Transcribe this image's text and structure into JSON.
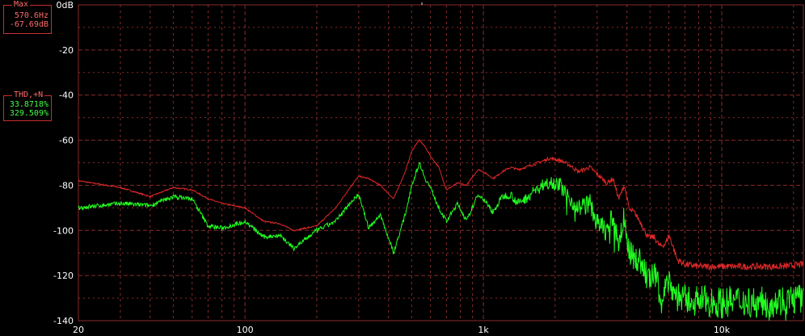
{
  "readouts": {
    "max": {
      "title": "Max",
      "frequency": "570.6Hz",
      "level": "-67.69dB"
    },
    "thd": {
      "title": "THD,+N",
      "value1": "33.8718%",
      "value2": "329.509%"
    }
  },
  "colors": {
    "background": "#000000",
    "grid": "#8a2a2a",
    "series_total": "#e02828",
    "series_residual": "#22ff22",
    "text": "#ffffff"
  },
  "chart_data": {
    "type": "line",
    "title": "",
    "xlabel": "",
    "ylabel": "",
    "x_scale": "log",
    "xlim": [
      20,
      22000
    ],
    "ylim": [
      -140,
      0
    ],
    "y_ticks": [
      0,
      -20,
      -40,
      -60,
      -80,
      -100,
      -120,
      -140
    ],
    "y_tick_labels": [
      "0dB",
      "-20",
      "-40",
      "-60",
      "-80",
      "-100",
      "-120",
      "-140"
    ],
    "x_ticks": [
      20,
      100,
      1000,
      10000
    ],
    "x_tick_labels": [
      "20",
      "100",
      "1k",
      "10k"
    ],
    "grid": true,
    "series": [
      {
        "color": "#e02828",
        "x": [
          20,
          30,
          40,
          50,
          60,
          70,
          80,
          100,
          120,
          140,
          160,
          200,
          240,
          280,
          300,
          330,
          370,
          420,
          470,
          500,
          520,
          540,
          570,
          600,
          650,
          700,
          780,
          850,
          950,
          1000,
          1100,
          1200,
          1300,
          1400,
          1500,
          1700,
          1900,
          2100,
          2300,
          2500,
          2800,
          3000,
          3300,
          3500,
          3700,
          3900,
          4100,
          4300,
          4600,
          4900,
          5200,
          5500,
          5800,
          6000,
          6200,
          6500,
          7000,
          8000,
          10000,
          12000,
          15000,
          18000,
          22000
        ],
        "y": [
          -78,
          -81,
          -85,
          -81,
          -82,
          -86,
          -88,
          -90,
          -96,
          -97,
          -100,
          -98,
          -90,
          -80,
          -76,
          -77,
          -80,
          -86,
          -74,
          -65,
          -62,
          -60,
          -63,
          -67,
          -72,
          -82,
          -79,
          -80,
          -73,
          -74,
          -77,
          -74,
          -72,
          -73,
          -72,
          -70,
          -68,
          -69,
          -71,
          -74,
          -72,
          -75,
          -79,
          -77,
          -86,
          -80,
          -91,
          -92,
          -97,
          -103,
          -103,
          -107,
          -106,
          -102,
          -106,
          -113,
          -115,
          -116,
          -116,
          -116,
          -116,
          -116,
          -115
        ]
      },
      {
        "color": "#22ff22",
        "x": [
          20,
          30,
          40,
          50,
          60,
          70,
          80,
          100,
          120,
          140,
          160,
          200,
          240,
          280,
          300,
          330,
          370,
          420,
          470,
          500,
          520,
          540,
          570,
          600,
          650,
          700,
          780,
          850,
          950,
          1000,
          1100,
          1200,
          1300,
          1400,
          1500,
          1700,
          1900,
          2100,
          2300,
          2500,
          2800,
          3000,
          3300,
          3500,
          3700,
          3900,
          4100,
          4300,
          4600,
          4900,
          5200,
          5500,
          5800,
          6000,
          6200,
          6500,
          7000,
          8000,
          10000,
          12000,
          15000,
          18000,
          22000
        ],
        "y": [
          -90,
          -88,
          -89,
          -85,
          -86,
          -98,
          -99,
          -96,
          -103,
          -102,
          -108,
          -100,
          -96,
          -87,
          -84,
          -99,
          -93,
          -110,
          -93,
          -80,
          -75,
          -70,
          -77,
          -81,
          -90,
          -96,
          -88,
          -96,
          -84,
          -86,
          -92,
          -85,
          -84,
          -88,
          -86,
          -81,
          -78,
          -80,
          -86,
          -90,
          -88,
          -97,
          -100,
          -94,
          -106,
          -94,
          -110,
          -112,
          -114,
          -122,
          -120,
          -127,
          -126,
          -121,
          -126,
          -129,
          -131,
          -131,
          -132,
          -131,
          -132,
          -131,
          -130
        ]
      }
    ]
  }
}
